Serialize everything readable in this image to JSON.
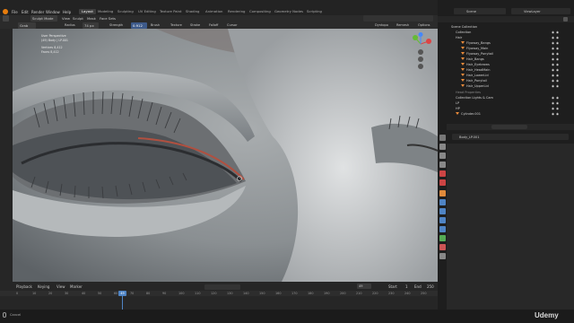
{
  "topbar": {
    "menu": [
      "File",
      "Edit",
      "Render",
      "Window",
      "Help"
    ],
    "workspaces": [
      "Layout",
      "Modeling",
      "Sculpting",
      "UV Editing",
      "Texture Paint",
      "Shading",
      "Animation",
      "Rendering",
      "Compositing",
      "Geometry Nodes",
      "Scripting"
    ],
    "scene_label": "Scene",
    "viewlayer_label": "ViewLayer"
  },
  "viewport_header": {
    "mode": "Sculpt Mode",
    "menus": [
      "View",
      "Sculpt",
      "Mask",
      "Face Sets"
    ],
    "brush_name": "Grab",
    "radius_label": "Radius",
    "radius_value": "74 px",
    "strength_label": "Strength",
    "strength_value": "0.912",
    "dropdowns": [
      "Brush",
      "Texture",
      "Stroke",
      "Falloff",
      "Cursor"
    ],
    "right_labels": [
      "Dyntopo",
      "Remesh",
      "Options"
    ]
  },
  "viewport_overlay": {
    "lines": [
      "User Perspective",
      "(49) Body | LP.001",
      "",
      "Vertices 8,412",
      "Faces 8,412"
    ]
  },
  "gizmo": {
    "x": "X",
    "y": "Y",
    "z": "Z"
  },
  "timeline": {
    "menus": [
      "Playback",
      "Keying",
      "View",
      "Marker"
    ],
    "frame_numbers": [
      "0",
      "10",
      "20",
      "30",
      "40",
      "50",
      "60",
      "70",
      "80",
      "90",
      "100",
      "110",
      "120",
      "130",
      "140",
      "150",
      "160",
      "170",
      "180",
      "190",
      "200",
      "210",
      "220",
      "230",
      "240",
      "250"
    ],
    "current_frame": "49",
    "current_frame_box": "49",
    "start_label": "Start",
    "start_value": "1",
    "end_label": "End",
    "end_value": "250"
  },
  "statusbar": {
    "left_text": "Cancel",
    "watermark": "Udemy"
  },
  "outliner": {
    "title": "Scene Collection",
    "rows": [
      "Collection",
      "Hair",
      "Flyaway_Bangs",
      "Flyaway_Main",
      "Flyaway_Ponytail",
      "Hair_Bangs",
      "Hair_Eyebrows",
      "Hair_HeadMain",
      "Hair_LowerLid",
      "Hair_Ponytail",
      "Hair_UpperLid",
      "Head Properties",
      "Collection Lights & Cam",
      "LP",
      "HP",
      "Cylinder.001"
    ],
    "search_placeholder": ""
  },
  "properties": {
    "object_name": "Body_LP.001"
  }
}
